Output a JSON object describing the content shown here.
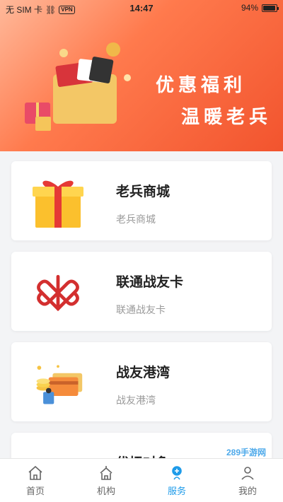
{
  "status": {
    "carrier": "无 SIM 卡",
    "vpn": "VPN",
    "time": "14:47",
    "battery": "94%",
    "battery_level": 0.94
  },
  "banner": {
    "line1": "优惠福利",
    "line2": "温暖老兵"
  },
  "cards": [
    {
      "title": "老兵商城",
      "subtitle": "老兵商城",
      "icon": "gift-box-icon"
    },
    {
      "title": "联通战友卡",
      "subtitle": "联通战友卡",
      "icon": "china-unicom-logo-icon"
    },
    {
      "title": "战友港湾",
      "subtitle": "战友港湾",
      "icon": "coins-cards-icon"
    },
    {
      "title": "优抚对象",
      "subtitle": "",
      "icon": "phone-card-icon"
    }
  ],
  "tabs": [
    {
      "label": "首页",
      "icon": "home-icon",
      "active": false
    },
    {
      "label": "机构",
      "icon": "building-icon",
      "active": false
    },
    {
      "label": "服务",
      "icon": "service-icon",
      "active": true
    },
    {
      "label": "我的",
      "icon": "profile-icon",
      "active": false
    }
  ],
  "watermark": "289手游网",
  "colors": {
    "accent": "#1e9be9",
    "banner": "#f2542e"
  }
}
